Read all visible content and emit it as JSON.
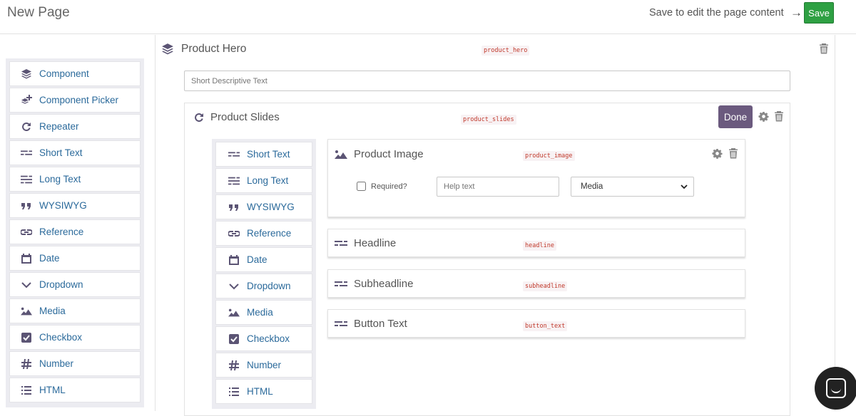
{
  "header": {
    "page_title": "New Page",
    "save_hint": "Save to edit the page content",
    "save_label": "Save"
  },
  "palette": [
    {
      "label": "Component",
      "icon": "layers-icon"
    },
    {
      "label": "Component Picker",
      "icon": "layers-add-icon"
    },
    {
      "label": "Repeater",
      "icon": "repeat-icon"
    },
    {
      "label": "Short Text",
      "icon": "short-text-icon"
    },
    {
      "label": "Long Text",
      "icon": "long-text-icon"
    },
    {
      "label": "WYSIWYG",
      "icon": "quote-icon"
    },
    {
      "label": "Reference",
      "icon": "link-icon"
    },
    {
      "label": "Date",
      "icon": "calendar-icon"
    },
    {
      "label": "Dropdown",
      "icon": "chevron-down-icon"
    },
    {
      "label": "Media",
      "icon": "image-icon"
    },
    {
      "label": "Checkbox",
      "icon": "checkbox-icon"
    },
    {
      "label": "Number",
      "icon": "hash-icon"
    },
    {
      "label": "HTML",
      "icon": "list-icon"
    }
  ],
  "inner_palette": [
    {
      "label": "Short Text",
      "icon": "short-text-icon"
    },
    {
      "label": "Long Text",
      "icon": "long-text-icon"
    },
    {
      "label": "WYSIWYG",
      "icon": "quote-icon"
    },
    {
      "label": "Reference",
      "icon": "link-icon"
    },
    {
      "label": "Date",
      "icon": "calendar-icon"
    },
    {
      "label": "Dropdown",
      "icon": "chevron-down-icon"
    },
    {
      "label": "Media",
      "icon": "image-icon"
    },
    {
      "label": "Checkbox",
      "icon": "checkbox-icon"
    },
    {
      "label": "Number",
      "icon": "hash-icon"
    },
    {
      "label": "HTML",
      "icon": "list-icon"
    }
  ],
  "hero": {
    "title": "Product Hero",
    "key": "product_hero",
    "short_text_placeholder": "Short Descriptive Text"
  },
  "slides": {
    "title": "Product Slides",
    "key": "product_slides",
    "done_label": "Done",
    "fields": [
      {
        "title": "Product Image",
        "key": "product_image",
        "icon": "image-icon",
        "required_label": "Required?",
        "help_placeholder": "Help text",
        "type_value": "Media"
      },
      {
        "title": "Headline",
        "key": "headline",
        "icon": "short-text-icon"
      },
      {
        "title": "Subheadline",
        "key": "subheadline",
        "icon": "short-text-icon"
      },
      {
        "title": "Button Text",
        "key": "button_text",
        "icon": "short-text-icon"
      }
    ]
  },
  "colors": {
    "accent": "#2b6a9b",
    "save": "#2ea043",
    "done": "#6b5a7e",
    "code": "#c0392b"
  }
}
